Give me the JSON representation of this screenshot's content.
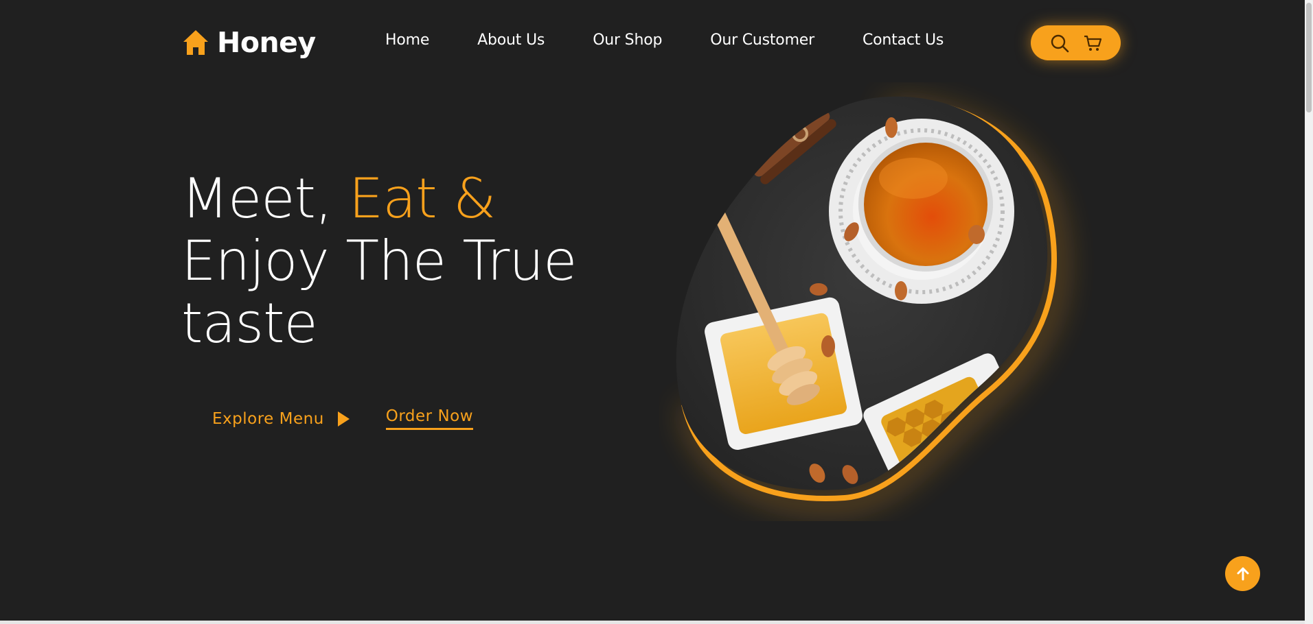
{
  "brand": {
    "name": "Honey",
    "icon": "home-icon",
    "accent": "#f8a11c"
  },
  "nav": {
    "items": [
      {
        "label": "Home"
      },
      {
        "label": "About Us"
      },
      {
        "label": "Our Shop"
      },
      {
        "label": "Our Customer"
      },
      {
        "label": "Contact Us"
      }
    ]
  },
  "header_icons": {
    "search": "search-icon",
    "cart": "cart-icon"
  },
  "hero": {
    "line1_white": "Meet, ",
    "line1_accent": "Eat &",
    "line2": "Enjoy The True",
    "line3": "taste",
    "explore_label": "Explore Menu",
    "order_label": "Order Now"
  },
  "back_to_top_icon": "arrow-up-icon",
  "colors": {
    "background": "#202020",
    "accent": "#f8a11c",
    "text": "#ffffff"
  }
}
